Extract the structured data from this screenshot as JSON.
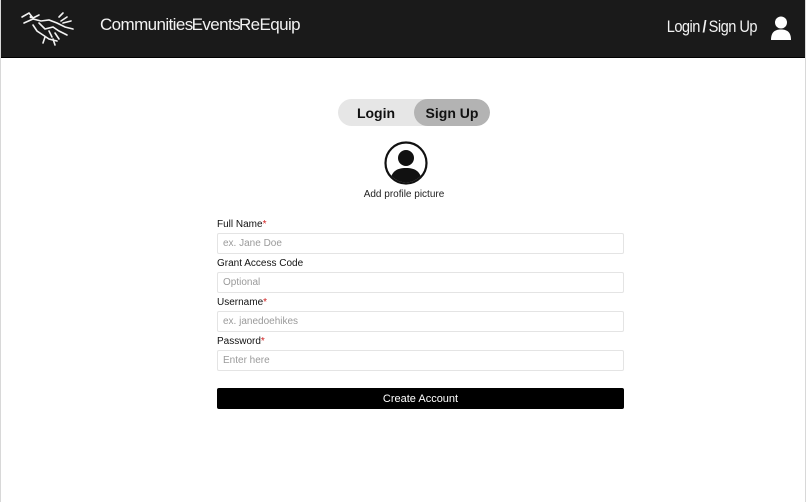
{
  "header": {
    "nav": [
      "Communities",
      "Events",
      "ReEquip"
    ],
    "login_label": "Login",
    "slash": "/",
    "signup_label": "Sign Up"
  },
  "toggle": {
    "login": "Login",
    "signup": "Sign Up",
    "active": "signup"
  },
  "avatar": {
    "caption": "Add profile picture"
  },
  "form": {
    "fields": [
      {
        "label": "Full Name",
        "required": "*",
        "placeholder": "ex. Jane Doe"
      },
      {
        "label": "Grant Access Code",
        "required": "",
        "placeholder": "Optional"
      },
      {
        "label": "Username",
        "required": "*",
        "placeholder": "ex. janedoehikes"
      },
      {
        "label": "Password",
        "required": "*",
        "placeholder": "Enter here"
      }
    ],
    "submit": "Create Account"
  },
  "colors": {
    "header_bg": "#1a1a1a",
    "required": "#d02020",
    "button_bg": "#000000"
  },
  "icons": {
    "logo": "archaeopteryx-logo-icon",
    "user": "user-icon",
    "avatar": "profile-avatar-icon"
  }
}
